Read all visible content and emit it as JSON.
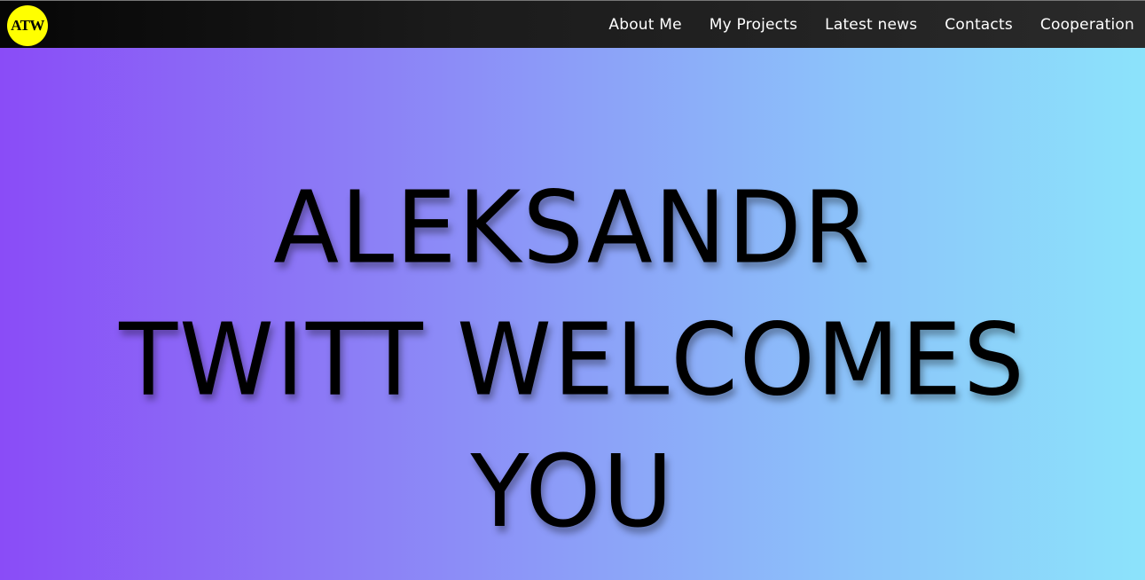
{
  "header": {
    "logo_text": "ATW",
    "nav": [
      {
        "label": "About Me"
      },
      {
        "label": "My Projects"
      },
      {
        "label": "Latest news"
      },
      {
        "label": "Contacts"
      },
      {
        "label": "Cooperation"
      }
    ]
  },
  "hero": {
    "headline_lines": [
      "ALEKSANDR",
      "TWITT WELCOMES",
      "YOU"
    ]
  },
  "colors": {
    "logo_bg": "#ffff00",
    "header_bg": "#1b1b1b",
    "hero_gradient_start": "#8a4cf7",
    "hero_gradient_end": "#8ce3fb",
    "headline": "#000000"
  }
}
